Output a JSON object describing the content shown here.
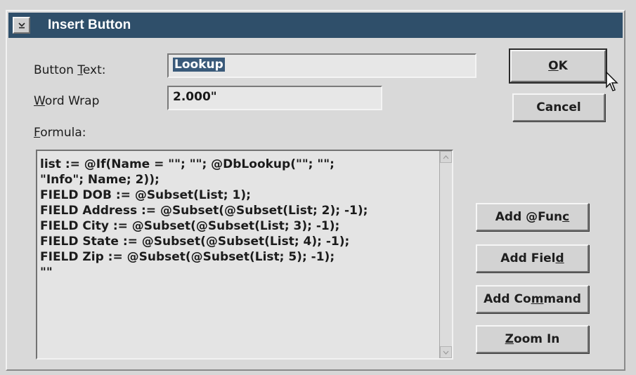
{
  "window": {
    "title": "Insert Button",
    "sys_menu_icon": "chevron-down-icon"
  },
  "fields": {
    "button_text_label_pre": "Button ",
    "button_text_label_accel": "T",
    "button_text_label_post": "ext:",
    "button_text_value": "Lookup",
    "word_wrap_label_accel": "W",
    "word_wrap_label_post": "ord Wrap",
    "word_wrap_value": "2.000\"",
    "formula_label_accel": "F",
    "formula_label_post": "ormula:"
  },
  "formula_lines": [
    "list := @If(Name = \"\"; \"\"; @DbLookup(\"\"; \"\";",
    "\"Info\"; Name; 2));",
    "FIELD DOB := @Subset(List; 1);",
    "FIELD Address := @Subset(@Subset(List; 2); -1);",
    "FIELD City := @Subset(@Subset(List; 3); -1);",
    "FIELD State := @Subset(@Subset(List; 4); -1);",
    "FIELD Zip := @Subset(@Subset(List; 5); -1);",
    "\"\""
  ],
  "buttons": {
    "ok_accel": "O",
    "ok_post": "K",
    "cancel": "Cancel",
    "add_func_pre": "Add @Fun",
    "add_func_accel": "c",
    "add_field_pre": "Add Fiel",
    "add_field_accel": "d",
    "add_command_pre": "Add Co",
    "add_command_accel": "m",
    "add_command_post": "mand",
    "zoom_in_accel": "Z",
    "zoom_in_post": "oom In"
  },
  "colors": {
    "titlebar": "#2f4f6a",
    "selection": "#3a5a7a",
    "dialog_bg": "#d9d9d9"
  }
}
